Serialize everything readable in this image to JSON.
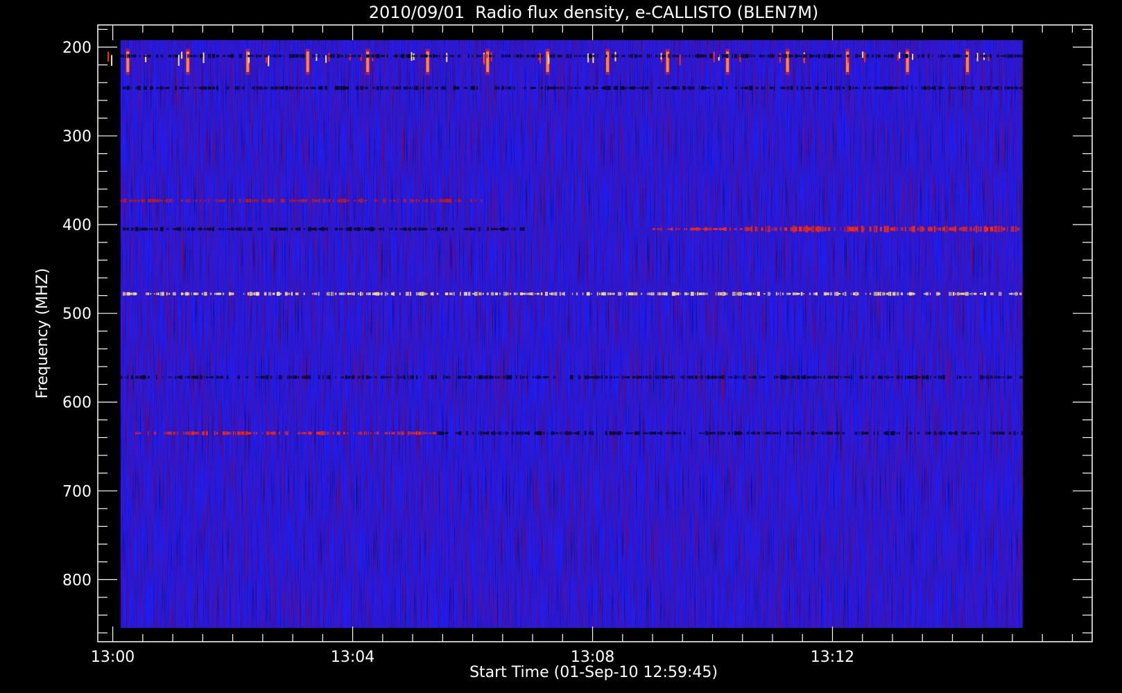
{
  "chart_data": {
    "type": "heatmap",
    "title": "2010/09/01  Radio flux density, e-CALLISTO (BLEN7M)",
    "xlabel": "Start Time (01-Sep-10 12:59:45)",
    "ylabel": "Frequency (MHZ)",
    "x_range_minutes_after_1300": [
      -0.25,
      16.33
    ],
    "data_time_range_minutes_after_1300": [
      0.13,
      15.17
    ],
    "ylim_mhz": [
      175,
      870
    ],
    "y_inverted": true,
    "xticks": [
      {
        "minute": 0,
        "label": "13:00"
      },
      {
        "minute": 4,
        "label": "13:04"
      },
      {
        "minute": 8,
        "label": "13:08"
      },
      {
        "minute": 12,
        "label": "13:12"
      }
    ],
    "yticks": [
      {
        "mhz": 200,
        "label": "200"
      },
      {
        "mhz": 300,
        "label": "300"
      },
      {
        "mhz": 400,
        "label": "400"
      },
      {
        "mhz": 500,
        "label": "500"
      },
      {
        "mhz": 600,
        "label": "600"
      },
      {
        "mhz": 700,
        "label": "700"
      },
      {
        "mhz": 800,
        "label": "800"
      }
    ],
    "colormap": {
      "background": "#1e1ef2",
      "dark": "#050520",
      "mid": "#c81818",
      "hot": "#ff2a00",
      "hottest": "#ffe080"
    },
    "features": [
      {
        "name": "periodic spikes",
        "mhz_range": [
          205,
          228
        ],
        "t_start": 0.25,
        "t_end": 15.1,
        "period_min": 1.0
      },
      {
        "name": "band",
        "mhz": 210,
        "t_start": 0.13,
        "t_end": 15.17,
        "intensity": "dark"
      },
      {
        "name": "band",
        "mhz": 246,
        "t_start": 0.13,
        "t_end": 15.17,
        "intensity": "dark"
      },
      {
        "name": "band",
        "mhz": 373,
        "t_start": 0.13,
        "t_end": 6.2,
        "intensity": "mid"
      },
      {
        "name": "band",
        "mhz": 405,
        "t_start": 0.13,
        "t_end": 6.9,
        "intensity": "dark"
      },
      {
        "name": "band",
        "mhz": 405,
        "t_start": 9.0,
        "t_end": 10.5,
        "intensity": "hot"
      },
      {
        "name": "band",
        "mhz": 405,
        "t_start": 10.5,
        "t_end": 15.17,
        "intensity": "hot"
      },
      {
        "name": "band",
        "mhz": 478,
        "t_start": 0.13,
        "t_end": 15.17,
        "intensity": "hottest"
      },
      {
        "name": "band",
        "mhz": 572,
        "t_start": 0.13,
        "t_end": 15.17,
        "intensity": "dark"
      },
      {
        "name": "band",
        "mhz": 635,
        "t_start": 0.13,
        "t_end": 5.4,
        "intensity": "hot"
      },
      {
        "name": "band",
        "mhz": 635,
        "t_start": 5.4,
        "t_end": 15.17,
        "intensity": "dark"
      }
    ]
  }
}
